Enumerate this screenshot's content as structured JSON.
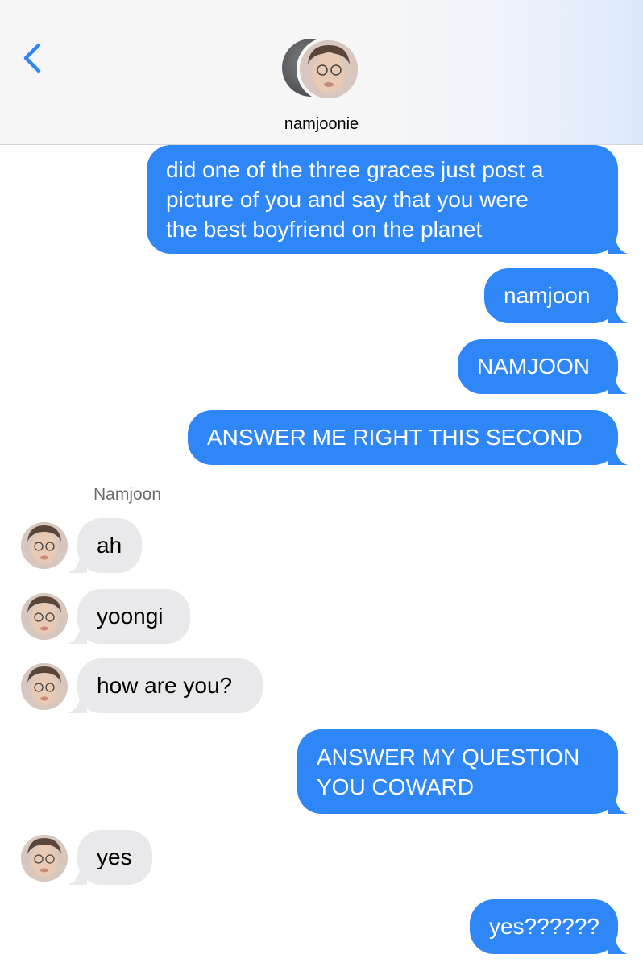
{
  "header": {
    "contact_name": "namjoonie"
  },
  "icons": {
    "back": "chevron-left-icon",
    "avatar": "contact-avatar"
  },
  "colors": {
    "outgoing": "#2e86f7",
    "incoming": "#e9e9eb",
    "back": "#2e86f7"
  },
  "sender_name": "Namjoon",
  "messages": [
    {
      "dir": "out",
      "lines": [
        "did one of the three graces just post a",
        "picture of you and say that you were",
        "the best boyfriend on the planet"
      ]
    },
    {
      "dir": "out",
      "lines": [
        "namjoon"
      ]
    },
    {
      "dir": "out",
      "lines": [
        "NAMJOON"
      ]
    },
    {
      "dir": "out",
      "lines": [
        "ANSWER ME RIGHT THIS SECOND"
      ]
    },
    {
      "dir": "in",
      "lines": [
        "ah"
      ]
    },
    {
      "dir": "in",
      "lines": [
        "yoongi"
      ]
    },
    {
      "dir": "in",
      "lines": [
        "how are you?"
      ]
    },
    {
      "dir": "out",
      "lines": [
        "ANSWER MY QUESTION",
        "YOU COWARD"
      ]
    },
    {
      "dir": "in",
      "lines": [
        "yes"
      ]
    },
    {
      "dir": "out",
      "lines": [
        "yes??????"
      ]
    }
  ]
}
